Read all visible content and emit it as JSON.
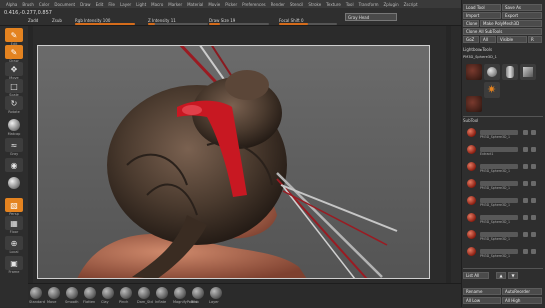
{
  "menu": [
    "Alpha",
    "Brush",
    "Color",
    "Document",
    "Draw",
    "Edit",
    "File",
    "Layer",
    "Light",
    "Macro",
    "Marker",
    "Material",
    "Movie",
    "Picker",
    "Preferences",
    "Render",
    "Stencil",
    "Stroke",
    "Texture",
    "Tool",
    "Transform",
    "Zplugin",
    "Zscript"
  ],
  "toolbar": {
    "coords": "0.416,-0.277,0.857",
    "items": [
      {
        "label": "Zadd"
      },
      {
        "label": "Zsub"
      },
      {
        "label": "Rgb Intensity 100",
        "fill": 1.0
      },
      {
        "label": "Z Intensity 11",
        "fill": 0.11
      },
      {
        "label": "Draw Size 19",
        "fill": 0.19
      },
      {
        "label": "Focal Shift 0",
        "fill": 0.5
      }
    ],
    "brush_field": "Gray Head"
  },
  "left_shelf": {
    "labels": [
      "Edit",
      "Draw",
      "Move",
      "Scale",
      "Rotate",
      "Rgb",
      "Zadd",
      "Zsub",
      "Matcap",
      "Gray",
      "Persp",
      "Floor",
      "Local",
      "Frame",
      "Move",
      "Scale",
      "Rotate",
      "Transp"
    ]
  },
  "right_panel": {
    "buttons": [
      [
        "Load Tool",
        "Save As"
      ],
      [
        "Import",
        "Export"
      ],
      [
        "Clone",
        "Make PolyMesh3D"
      ],
      [
        "Clone All SubTools"
      ],
      [
        "GoZ",
        "All",
        "Visible",
        "R"
      ]
    ],
    "lightbox_title": "Lightbox▸Tools",
    "current_tool": "PM3D_Sphere3D_1",
    "thumbs": [
      "PM3D_Sphere3D_1",
      "Cylinder3D",
      "PolyMesh3D",
      "SimpleBrush"
    ],
    "subtool_title": "SubTool",
    "subtools": [
      "PM3D_Sphere3D_1",
      "Extract1",
      "PM3D_Sphere3D_1",
      "PM3D_Sphere3D_1",
      "PM3D_Sphere3D_1",
      "PM3D_Sphere3D_1",
      "PM3D_Sphere3D_1",
      "PM3D_Sphere3D_1"
    ],
    "bottom_buttons": [
      [
        "List All"
      ],
      [
        "Rename",
        "AutoReorder"
      ],
      [
        "All Low",
        "All High"
      ]
    ]
  },
  "bottom_shelf": {
    "brushes": [
      "Standard",
      "Move",
      "Smooth",
      "Flatten",
      "Clay",
      "Pinch",
      "Dam_Std",
      "Inflate",
      "MagnifyPoints",
      "Blob",
      "Layer"
    ]
  },
  "colors": {
    "accent": "#e48320",
    "hair": "#4a3a2e",
    "ribbon": "#c81822",
    "skin": "#b06a52"
  }
}
